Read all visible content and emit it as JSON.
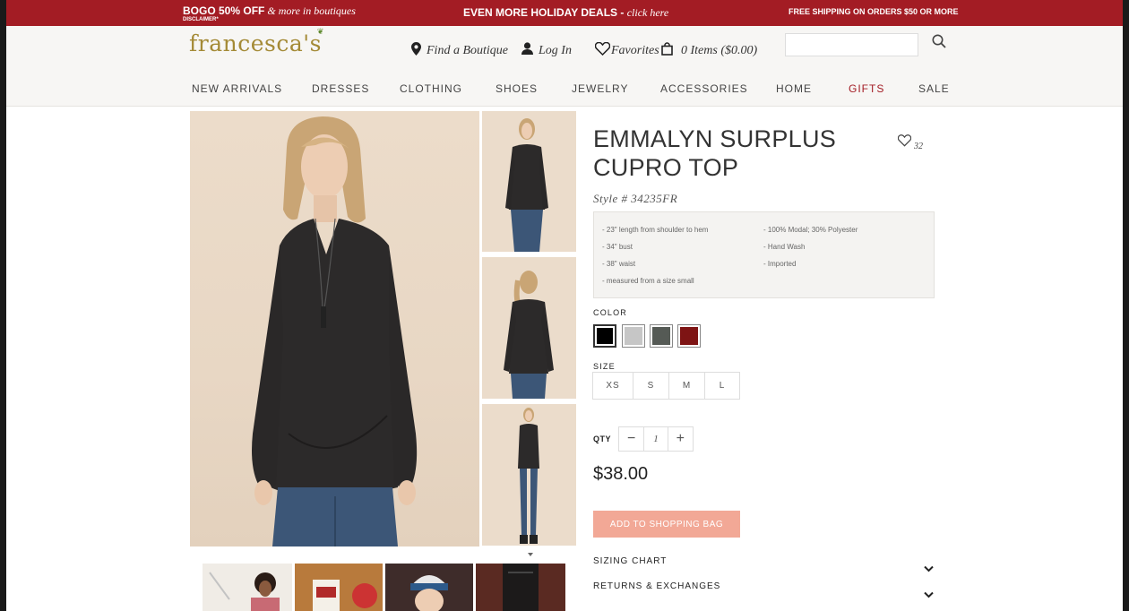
{
  "promo": {
    "left_bold": "BOGO 50% OFF",
    "left_italic": " & more in boutiques",
    "disclaimer": "DISCLAIMER*",
    "center_bold": "EVEN MORE HOLIDAY DEALS - ",
    "center_italic": "click here",
    "right": "FREE SHIPPING ON ORDERS $50 OR MORE"
  },
  "header": {
    "logo": "francesca's",
    "find_boutique": "Find a Boutique",
    "log_in": "Log In",
    "favorites": "Favorites",
    "bag": "0 Items ($0.00)",
    "search_value": ""
  },
  "nav": [
    "NEW ARRIVALS",
    "DRESSES",
    "CLOTHING",
    "SHOES",
    "JEWELRY",
    "ACCESSORIES",
    "HOME",
    "GIFTS",
    "SALE"
  ],
  "product": {
    "title": "EMMALYN SURPLUS CUPRO TOP",
    "favorite_count": "32",
    "style": "Style # 34235FR",
    "specs_left": [
      "- 23\" length from shoulder to hem",
      "- 34\" bust",
      "- 38\" waist",
      "- measured from a size small"
    ],
    "specs_right": [
      "- 100% Modal; 30% Polyester",
      "- Hand Wash",
      "- Imported"
    ],
    "color_label": "COLOR",
    "colors": [
      "#000000",
      "#c6c6c6",
      "#555a55",
      "#7e1414"
    ],
    "size_label": "SIZE",
    "sizes": [
      "XS",
      "S",
      "M",
      "L"
    ],
    "qty_label": "QTY",
    "qty_minus": "−",
    "qty_value": "1",
    "qty_plus": "+",
    "price": "$38.00",
    "add_button": "ADD TO SHOPPING BAG",
    "accordions": [
      "SIZING CHART",
      "RETURNS & EXCHANGES"
    ]
  }
}
